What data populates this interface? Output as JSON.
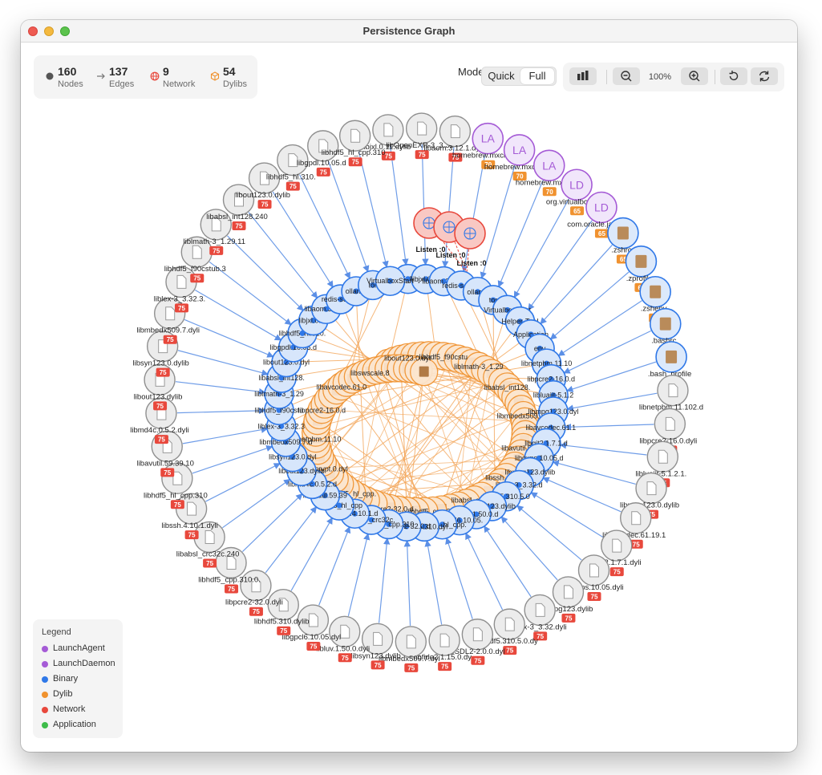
{
  "window": {
    "title": "Persistence Graph"
  },
  "stats": [
    {
      "value": "160",
      "label": "Nodes",
      "icon": "circle-dot-icon"
    },
    {
      "value": "137",
      "label": "Edges",
      "icon": "arrow-right-icon"
    },
    {
      "value": "9",
      "label": "Network",
      "icon": "globe-icon"
    },
    {
      "value": "54",
      "label": "Dylibs",
      "icon": "box-icon"
    }
  ],
  "mode": {
    "label": "Mode",
    "options": [
      "Quick",
      "Full"
    ],
    "selected": "Full"
  },
  "toolbar": {
    "zoom": "100%"
  },
  "legend": {
    "title": "Legend",
    "items": [
      {
        "label": "LaunchAgent",
        "color": "#a55bd6"
      },
      {
        "label": "LaunchDaemon",
        "color": "#a55bd6"
      },
      {
        "label": "Binary",
        "color": "#2f78e8"
      },
      {
        "label": "Dylib",
        "color": "#f0922f"
      },
      {
        "label": "Network",
        "color": "#e8483c"
      },
      {
        "label": "Application",
        "color": "#3ebc4a"
      }
    ]
  },
  "colors": {
    "binary": "#2f78e8",
    "dylib": "#f0922f",
    "network": "#e8483c",
    "launchd": "#a55bd6",
    "badge": "#e8483c",
    "outer": "#8f8f8f"
  },
  "graph": {
    "outer_nodes": [
      {
        "label": "libjxl.0.11.dylib",
        "badge": "75"
      },
      {
        "label": "libOpenEXR-3_3.32",
        "badge": "75"
      },
      {
        "label": "libaom.3.12.1.dyli",
        "badge": "75"
      },
      {
        "label": "homebrew.mxcl.redi",
        "badge": "70",
        "kind": "LA"
      },
      {
        "label": "homebrew.mxcl.olla",
        "badge": "70",
        "kind": "LA"
      },
      {
        "label": "homebrew.mxcl.tor",
        "badge": "70",
        "kind": "LA"
      },
      {
        "label": "org.virtualbox.sta",
        "badge": "65",
        "kind": "LD"
      },
      {
        "label": "com.oracle.java.He",
        "badge": "65",
        "kind": "LD"
      },
      {
        "label": ".zshrc",
        "badge": "65",
        "kind": "file"
      },
      {
        "label": ".zprofile",
        "badge": "65",
        "kind": "file"
      },
      {
        "label": ".zshenv",
        "badge": "65",
        "kind": "file"
      },
      {
        "label": ".bashrc",
        "badge": "65",
        "kind": "file"
      },
      {
        "label": ".bash_profile",
        "badge": "65",
        "kind": "file"
      },
      {
        "label": "libnetpbm.11.102.d",
        "badge": "75"
      },
      {
        "label": "libpcre2-16.0.dyli",
        "badge": "75"
      },
      {
        "label": "libluajit-5.1.2.1.",
        "badge": "75"
      },
      {
        "label": "libmpg123.0.dylib",
        "badge": "75"
      },
      {
        "label": "libavcodec.61.19.1",
        "badge": "75"
      },
      {
        "label": "libgit2.1.7.1.dyli",
        "badge": "75"
      },
      {
        "label": "libboxps.10.05.dyli",
        "badge": "75"
      },
      {
        "label": "libmpg123.dylib",
        "badge": "75"
      },
      {
        "label": "liblex-3_3.32.dyli",
        "badge": "75"
      },
      {
        "label": "libhdf5.310.5.0.dy",
        "badge": "75"
      },
      {
        "label": "libSDL2-2.0.0.dyl",
        "badge": "75"
      },
      {
        "label": "libfido2.1.15.0.dy",
        "badge": "75"
      },
      {
        "label": "libmbedx509.7.dyl",
        "badge": "75"
      },
      {
        "label": "libsyn123.dylib",
        "badge": "75"
      },
      {
        "label": "libluv.1.50.0.dyli",
        "badge": "75"
      },
      {
        "label": "libgpcl6.10.05.dyl",
        "badge": "75"
      },
      {
        "label": "libhdf5.310.dylib",
        "badge": "75"
      },
      {
        "label": "libpcre2-32.0.dyli",
        "badge": "75"
      },
      {
        "label": "libhdf5_cpp.310.0.",
        "badge": "75"
      },
      {
        "label": "libabsl_crc32c.240",
        "badge": "75"
      },
      {
        "label": "libssh.4.10.1.dyli",
        "badge": "75"
      },
      {
        "label": "libhdf5_hl_cpp.310",
        "badge": "75"
      },
      {
        "label": "libavutil.59.39.10",
        "badge": "75"
      },
      {
        "label": "libmd4c.0.5.2.dyli",
        "badge": "75"
      },
      {
        "label": "libout123.dylib",
        "badge": "75"
      },
      {
        "label": "libsyn123.0.dylib",
        "badge": "75"
      },
      {
        "label": "libmbedx509.7.dyli",
        "badge": "75"
      },
      {
        "label": "liblex-3_3.32.3.",
        "badge": "75"
      },
      {
        "label": "libhdf5_f90cstub.3",
        "badge": "75"
      },
      {
        "label": "liblmath-3_1.29.11",
        "badge": "75"
      },
      {
        "label": "libabsl_int128.240",
        "badge": "75"
      },
      {
        "label": "libout123.0.dylib",
        "badge": "75"
      },
      {
        "label": "libhdf5_hl.310.",
        "badge": "75"
      },
      {
        "label": "libgpdl.10.05.d",
        "badge": "75"
      },
      {
        "label": "libhdf5_hl_cpp.310",
        "badge": "75"
      }
    ],
    "middle_labels": [
      "libhdf5_hl.310.",
      "libjxl.0.11",
      "libaom.3.12.1",
      "redis-server",
      "ollama",
      "tor",
      "VirtualboxStart",
      "Helper-Tool",
      "Application",
      "env",
      "libnetpbm.11.10",
      "libpcre2-16.0.d",
      "libluajit-5.1.2",
      "libmpg123.0.dyl",
      "libavcodec.61.1",
      "libgit2.1.7.1.d",
      "libgxps.10.05.d",
      "libmpg123.dylib",
      "liblex-3_3.32.d",
      "libhdf5.310.5.0",
      "libsyn123.dylib",
      "libluv.1.50.0.d",
      "libgpcl6.10.05.",
      "libhdf5_hl_cpp.",
      "libhdf5.310.dyl",
      "libpcre2-32.0.d",
      "libhdf5_cpp.310",
      "libabsl_crc32c.",
      "libssh.4.10.1.d",
      "libhdf5_hl_cpp",
      "libavutil.59.39",
      "libmd4c.0.5.2.d",
      "libout123.dylib",
      "libsyn123.0.dyl",
      "libmbedx509.7.d",
      "liblex-3_3.32.3",
      "libhdf5_f90cstu",
      "liblmath-3_1.29",
      "libabsl_int128.",
      "libout123.0.dyl",
      "libgpdl.10.05.d"
    ],
    "network_labels": [
      "Listen :0",
      "Listen :0",
      "Listen :0"
    ],
    "inner_labels": [
      "libout123.0.dyl",
      "libhdf5_f90cstu",
      "liblmath-3_1.29",
      "libabsl_int128.",
      "libmbedx509.7.d",
      "libavutil.59.dy",
      "libssh.4.dylib",
      "libabsl_crc32c",
      "libhdf5_cpp.310",
      "libpcre2-32.0.d",
      "libhdf5_hl_cpp.",
      "libscrypt.0.dyl",
      "libnetpbm.11.10",
      "libpcre2-16.0.d",
      "libavcodec.61.0",
      "libswscale.8"
    ]
  }
}
